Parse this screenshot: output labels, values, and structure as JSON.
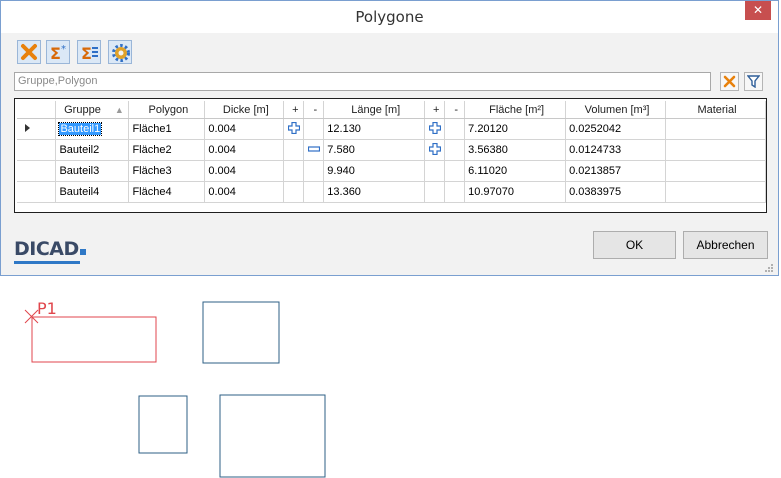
{
  "window": {
    "title": "Polygone",
    "close_glyph": "✕"
  },
  "toolbar": {
    "buttons": [
      {
        "name": "delete-button",
        "icon": "red-x-icon"
      },
      {
        "name": "sum-star-button",
        "icon": "sigma-star-icon",
        "glyph": "Σ",
        "sup": "*"
      },
      {
        "name": "sum-list-button",
        "icon": "sigma-list-icon",
        "glyph": "Σ"
      },
      {
        "name": "settings-button",
        "icon": "gear-icon"
      }
    ]
  },
  "filter": {
    "value": "Gruppe,Polygon"
  },
  "grid": {
    "headers": [
      "Gruppe",
      "Polygon",
      "Dicke [m]",
      "+",
      "-",
      "Länge [m]",
      "+",
      "-",
      "Fläche [m²]",
      "Volumen [m³]",
      "Material"
    ],
    "sort_column": "Gruppe",
    "rows": [
      {
        "gruppe": "Bauteil1",
        "polygon": "Fläche1",
        "dicke": "0.004",
        "plus1": "plus",
        "minus1": "",
        "laenge": "12.130",
        "plus2": "plus",
        "minus2": "",
        "flaeche": "7.20120",
        "volumen": "0.0252042",
        "material": "",
        "current": true
      },
      {
        "gruppe": "Bauteil2",
        "polygon": "Fläche2",
        "dicke": "0.004",
        "plus1": "",
        "minus1": "minus",
        "laenge": "7.580",
        "plus2": "plus",
        "minus2": "",
        "flaeche": "3.56380",
        "volumen": "0.0124733",
        "material": "",
        "current": false
      },
      {
        "gruppe": "Bauteil3",
        "polygon": "Fläche3",
        "dicke": "0.004",
        "plus1": "",
        "minus1": "",
        "laenge": "9.940",
        "plus2": "",
        "minus2": "",
        "flaeche": "6.11020",
        "volumen": "0.0213857",
        "material": "",
        "current": false
      },
      {
        "gruppe": "Bauteil4",
        "polygon": "Fläche4",
        "dicke": "0.004",
        "plus1": "",
        "minus1": "",
        "laenge": "13.360",
        "plus2": "",
        "minus2": "",
        "flaeche": "10.97070",
        "volumen": "0.0383975",
        "material": "",
        "current": false
      }
    ]
  },
  "footer": {
    "logo": "DICAD",
    "ok_label": "OK",
    "cancel_label": "Abbrechen"
  },
  "drawing": {
    "label": "P1",
    "colors": {
      "active": "#e0464c",
      "shape": "#2e5f86"
    }
  },
  "colors": {
    "accent": "#3399ff",
    "plus_icon": "#2f6fc6",
    "delete_icon": "#e8810c"
  }
}
